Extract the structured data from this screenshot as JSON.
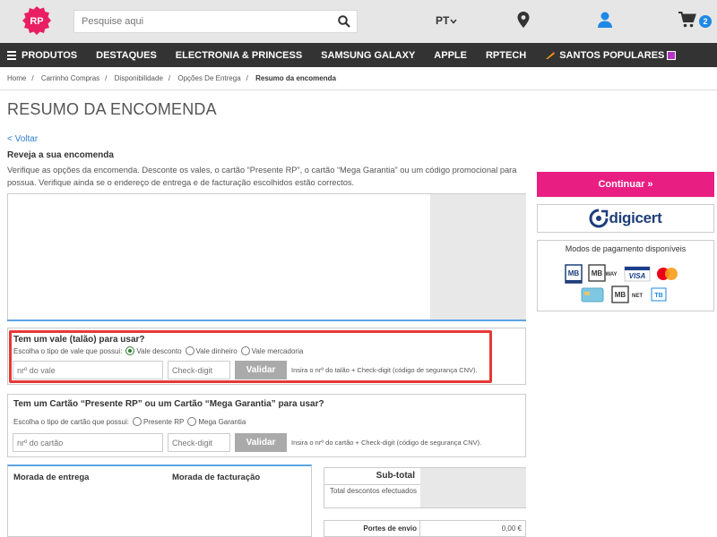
{
  "header": {
    "logo_text": "RP",
    "search_placeholder": "Pesquise aqui",
    "language": "PT",
    "cart_count": "2",
    "colors": {
      "brand": "#e91e63",
      "badge": "#1e88e5"
    }
  },
  "nav": {
    "items": [
      "PRODUTOS",
      "DESTAQUES",
      "ELECTRONIA & PRINCESS",
      "SAMSUNG GALAXY",
      "APPLE",
      "RPTECH",
      "SANTOS POPULARES"
    ]
  },
  "breadcrumb": {
    "items": [
      "Home",
      "Carrinho Compras",
      "Disponibilidade",
      "Opções De Entrega"
    ],
    "current": "Resumo da encomenda"
  },
  "page": {
    "title": "RESUMO DA ENCOMENDA",
    "back": "< Voltar",
    "review_title": "Reveja a sua encomenda",
    "review_text": "Verifique as opções da encomenda. Desconte os vales, o cartão “Presente RP”, o cartão “Mega Garantia” ou um código promocional para possua. Verifique ainda se o endereço de entrega e de facturação escolhidos estão correctos."
  },
  "voucher": {
    "title": "Tem um vale (talão) para usar?",
    "choose_label": "Escolha o tipo de vale que possui:",
    "options": [
      "Vale desconto",
      "Vale dinheiro",
      "Vale mercadoria"
    ],
    "selected": "Vale desconto",
    "number_placeholder": "nrº do vale",
    "check_placeholder": "Check-digit",
    "button": "Validar",
    "hint": "Insira o nrº do talão + Check-digit (código de segurança CNV)."
  },
  "card": {
    "title": "Tem um Cartão “Presente RP” ou um Cartão “Mega Garantia” para usar?",
    "choose_label": "Escolha o tipo de cartão que possui:",
    "options": [
      "Presente RP",
      "Mega Garantia"
    ],
    "number_placeholder": "nrº do cartão",
    "check_placeholder": "Check-digit",
    "button": "Validar",
    "hint": "Insira o nrº do cartão + Check-digit (código de segurança CNV)."
  },
  "address": {
    "shipping": "Morada de entrega",
    "billing": "Morada de facturação"
  },
  "totals": {
    "subtotal": "Sub-total",
    "discounts": "Total descontos efectuados",
    "shipping_label": "Portes de envio",
    "shipping_value": "0,00 €"
  },
  "sidebar": {
    "continue": "Continuar »",
    "digicert": "digicert",
    "payment_title": "Modos de pagamento disponíveis",
    "payment_methods": [
      "MB Multibanco",
      "MB WAY",
      "VISA",
      "Mastercard",
      "Card",
      "MB NET",
      "TB"
    ]
  }
}
